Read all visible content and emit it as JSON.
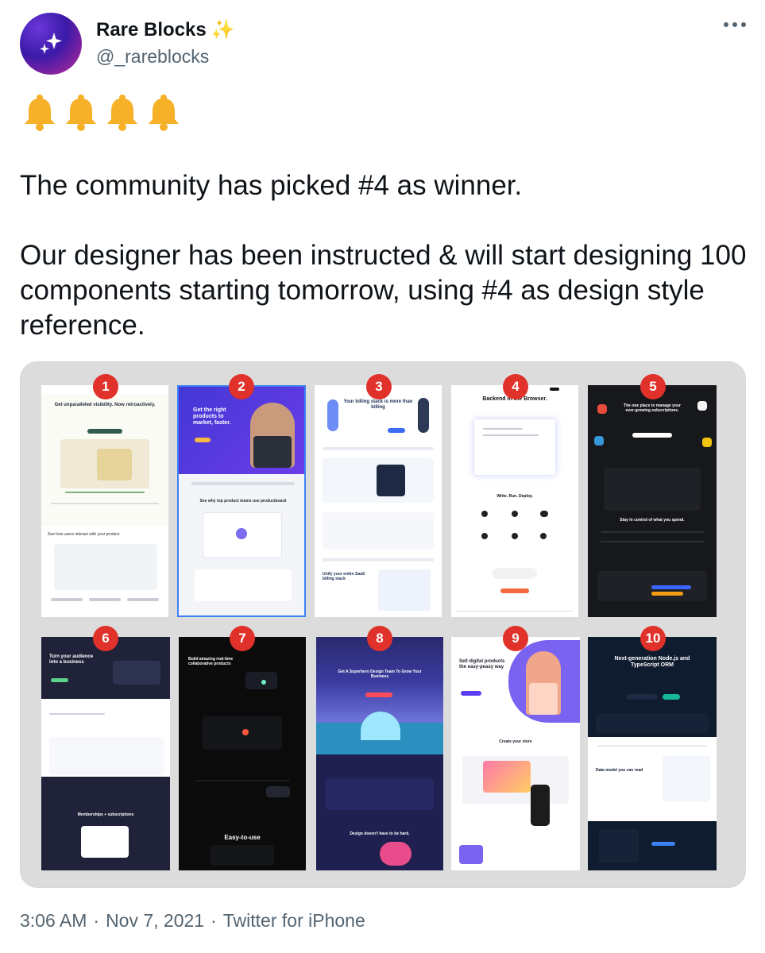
{
  "author": {
    "display_name": "Rare Blocks",
    "handle": "@_rareblocks",
    "verified_emoji": "sparkles-icon"
  },
  "tweet": {
    "emoji_row": [
      "bell-icon",
      "bell-icon",
      "bell-icon",
      "bell-icon"
    ],
    "paragraph_1": "The community has picked #4 as winner.",
    "paragraph_2": "Our designer has been instructed & will start designing 100 components starting tomorrow, using #4 as design style reference."
  },
  "media": {
    "tiles": [
      {
        "number": "1",
        "headline": "Get unparalleled visibility. Now retroactively.",
        "subheadline": "See how users interact with your product"
      },
      {
        "number": "2",
        "headline": "Get the right products to market, faster.",
        "subheadline": "See why top product teams use productboard"
      },
      {
        "number": "3",
        "headline": "Your billing stack is more than billing",
        "subheadline": "Unify your entire SaaS billing stack"
      },
      {
        "number": "4",
        "headline": "Backend in the Browser.",
        "subheadline": "Write. Run. Deploy."
      },
      {
        "number": "5",
        "headline": "The one place to manage your ever-growing subscriptions.",
        "subheadline": "Stay in control of what you spend."
      },
      {
        "number": "6",
        "headline": "Turn your audience into a business",
        "subheadline": "Memberships + subscriptions"
      },
      {
        "number": "7",
        "headline": "Build amazing real-time collaborative products",
        "subheadline": "Easy-to-use"
      },
      {
        "number": "8",
        "headline": "Get A Superhero Design Team To Grow Your Business",
        "subheadline": "Design doesn't have to be hard."
      },
      {
        "number": "9",
        "headline": "Sell digital products the easy-peasy way",
        "subheadline": "Create your store"
      },
      {
        "number": "10",
        "headline": "Next-generation Node.js and TypeScript ORM",
        "subheadline": "Data model you can read"
      }
    ]
  },
  "footer": {
    "time": "3:06 AM",
    "date": "Nov 7, 2021",
    "source": "Twitter for iPhone",
    "separator": "·"
  },
  "colors": {
    "badge_red": "#e0312a",
    "text_primary": "#0f1419",
    "text_secondary": "#536471",
    "bell_gold": "#f6b129"
  }
}
